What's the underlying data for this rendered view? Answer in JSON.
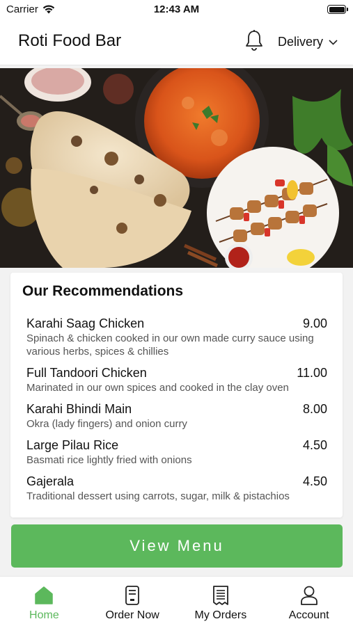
{
  "status_bar": {
    "carrier": "Carrier",
    "time": "12:43 AM"
  },
  "header": {
    "title": "Roti Food Bar",
    "delivery_label": "Delivery"
  },
  "recommendations": {
    "title": "Our Recommendations",
    "items": [
      {
        "name": "Karahi Saag Chicken",
        "price": "9.00",
        "description": "Spinach & chicken cooked in our own made curry sauce using various herbs, spices & chillies"
      },
      {
        "name": "Full Tandoori Chicken",
        "price": "11.00",
        "description": "Marinated in our own spices and cooked in the clay oven"
      },
      {
        "name": "Karahi Bhindi Main",
        "price": "8.00",
        "description": "Okra (lady fingers) and onion curry"
      },
      {
        "name": "Large Pilau Rice",
        "price": "4.50",
        "description": "Basmati rice lightly fried with onions"
      },
      {
        "name": "Gajerala",
        "price": "4.50",
        "description": "Traditional dessert using carrots, sugar, milk & pistachios"
      }
    ]
  },
  "view_menu_label": "View Menu",
  "tabs": [
    {
      "label": "Home",
      "icon": "home-icon",
      "active": true
    },
    {
      "label": "Order Now",
      "icon": "order-now-icon",
      "active": false
    },
    {
      "label": "My Orders",
      "icon": "receipt-icon",
      "active": false
    },
    {
      "label": "Account",
      "icon": "person-icon",
      "active": false
    }
  ],
  "colors": {
    "accent": "#5cb85c",
    "text": "#111111",
    "muted": "#555555"
  }
}
